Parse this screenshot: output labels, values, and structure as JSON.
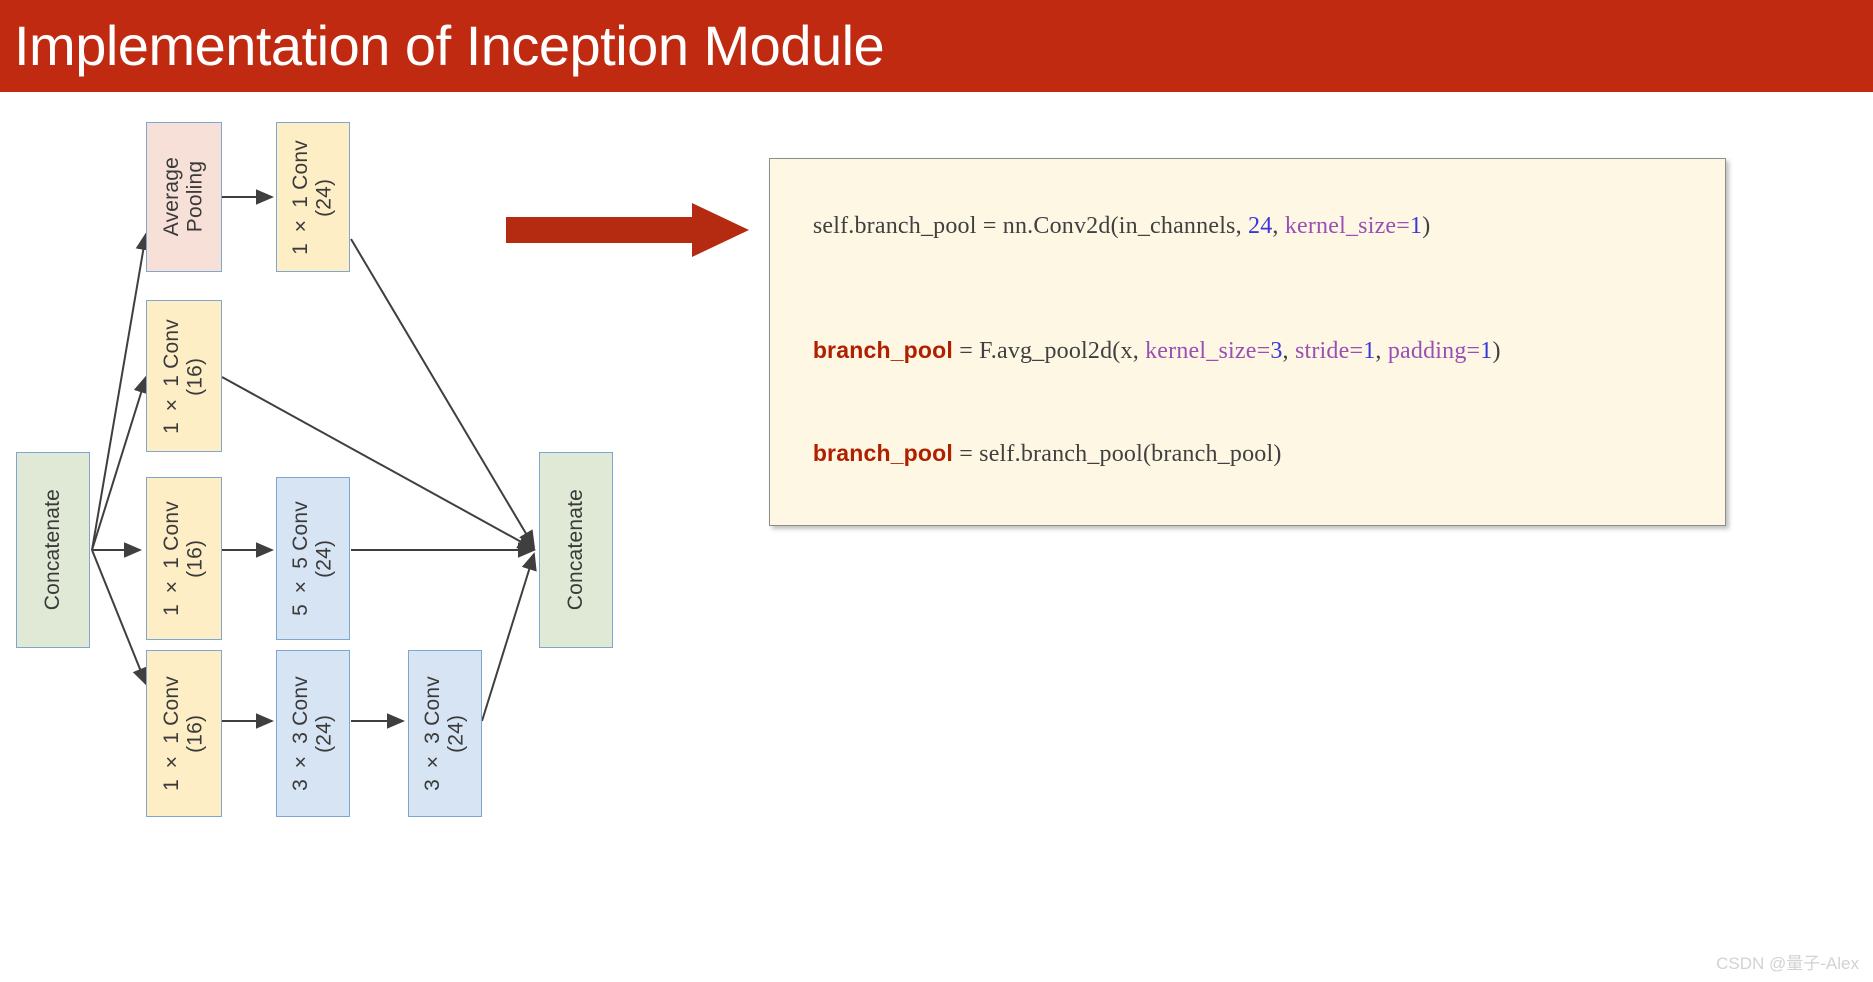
{
  "header": {
    "title": "Implementation of Inception Module",
    "background_color": "#bf2a10",
    "text_color": "#ffffff"
  },
  "diagram": {
    "type": "inception-module-block-diagram",
    "colors": {
      "concatenate_fill": "#dfe9d5",
      "pooling_fill": "#f7e0d8",
      "conv1x1_fill": "#fdeec6",
      "conv_large_fill": "#d6e4f4",
      "node_border": "#7ea6d0",
      "edge_color": "#3f3f3f",
      "red_arrow": "#b52b11"
    },
    "nodes": [
      {
        "id": "concat_in",
        "label": "Concatenate",
        "kind": "concat"
      },
      {
        "id": "avgpool",
        "label": "Average\nPooling",
        "kind": "pool"
      },
      {
        "id": "pool_conv",
        "label": "1 × 1 Conv\n(24)",
        "kind": "conv1"
      },
      {
        "id": "b1_conv1",
        "label": "1 × 1 Conv\n(16)",
        "kind": "conv1"
      },
      {
        "id": "b2_conv1",
        "label": "1 × 1 Conv\n(16)",
        "kind": "conv1"
      },
      {
        "id": "b2_conv5",
        "label": "5 × 5 Conv\n(24)",
        "kind": "convbig"
      },
      {
        "id": "b3_conv1",
        "label": "1 × 1 Conv\n(16)",
        "kind": "conv1"
      },
      {
        "id": "b3_conv3a",
        "label": "3 × 3 Conv\n(24)",
        "kind": "convbig"
      },
      {
        "id": "b3_conv3b",
        "label": "3 × 3 Conv\n(24)",
        "kind": "convbig"
      },
      {
        "id": "concat_out",
        "label": "Concatenate",
        "kind": "concat"
      }
    ],
    "edges": [
      {
        "from": "concat_in",
        "to": "avgpool"
      },
      {
        "from": "concat_in",
        "to": "b1_conv1"
      },
      {
        "from": "concat_in",
        "to": "b2_conv1"
      },
      {
        "from": "concat_in",
        "to": "b3_conv1"
      },
      {
        "from": "avgpool",
        "to": "pool_conv"
      },
      {
        "from": "pool_conv",
        "to": "concat_out"
      },
      {
        "from": "b1_conv1",
        "to": "concat_out"
      },
      {
        "from": "b2_conv1",
        "to": "b2_conv5"
      },
      {
        "from": "b2_conv5",
        "to": "concat_out"
      },
      {
        "from": "b3_conv1",
        "to": "b3_conv3a"
      },
      {
        "from": "b3_conv3a",
        "to": "b3_conv3b"
      },
      {
        "from": "b3_conv3b",
        "to": "concat_out"
      }
    ]
  },
  "code": {
    "background_color": "#fdf7e3",
    "border_color": "#8d8d8d",
    "lines": [
      {
        "segments": [
          {
            "text": "self.branch_pool = nn.Conv2d(in_channels, ",
            "style": "plain"
          },
          {
            "text": "24",
            "style": "num"
          },
          {
            "text": ", ",
            "style": "plain"
          },
          {
            "text": "kernel_size=",
            "style": "param"
          },
          {
            "text": "1",
            "style": "num"
          },
          {
            "text": ")",
            "style": "plain"
          }
        ]
      },
      {
        "spacer": true,
        "segments": []
      },
      {
        "segments": [
          {
            "text": "branch_pool",
            "style": "kw"
          },
          {
            "text": " = F.avg_pool2d(x, ",
            "style": "plain"
          },
          {
            "text": "kernel_size=",
            "style": "param"
          },
          {
            "text": "3",
            "style": "num"
          },
          {
            "text": ", ",
            "style": "plain"
          },
          {
            "text": "stride=",
            "style": "param"
          },
          {
            "text": "1",
            "style": "num"
          },
          {
            "text": ", ",
            "style": "plain"
          },
          {
            "text": "padding=",
            "style": "param"
          },
          {
            "text": "1",
            "style": "num"
          },
          {
            "text": ")",
            "style": "plain"
          }
        ]
      },
      {
        "segments": [
          {
            "text": "branch_pool",
            "style": "kw"
          },
          {
            "text": " = self.branch_pool(branch_pool)",
            "style": "plain"
          }
        ]
      }
    ]
  },
  "watermark": {
    "text": "CSDN @量子-Alex"
  }
}
